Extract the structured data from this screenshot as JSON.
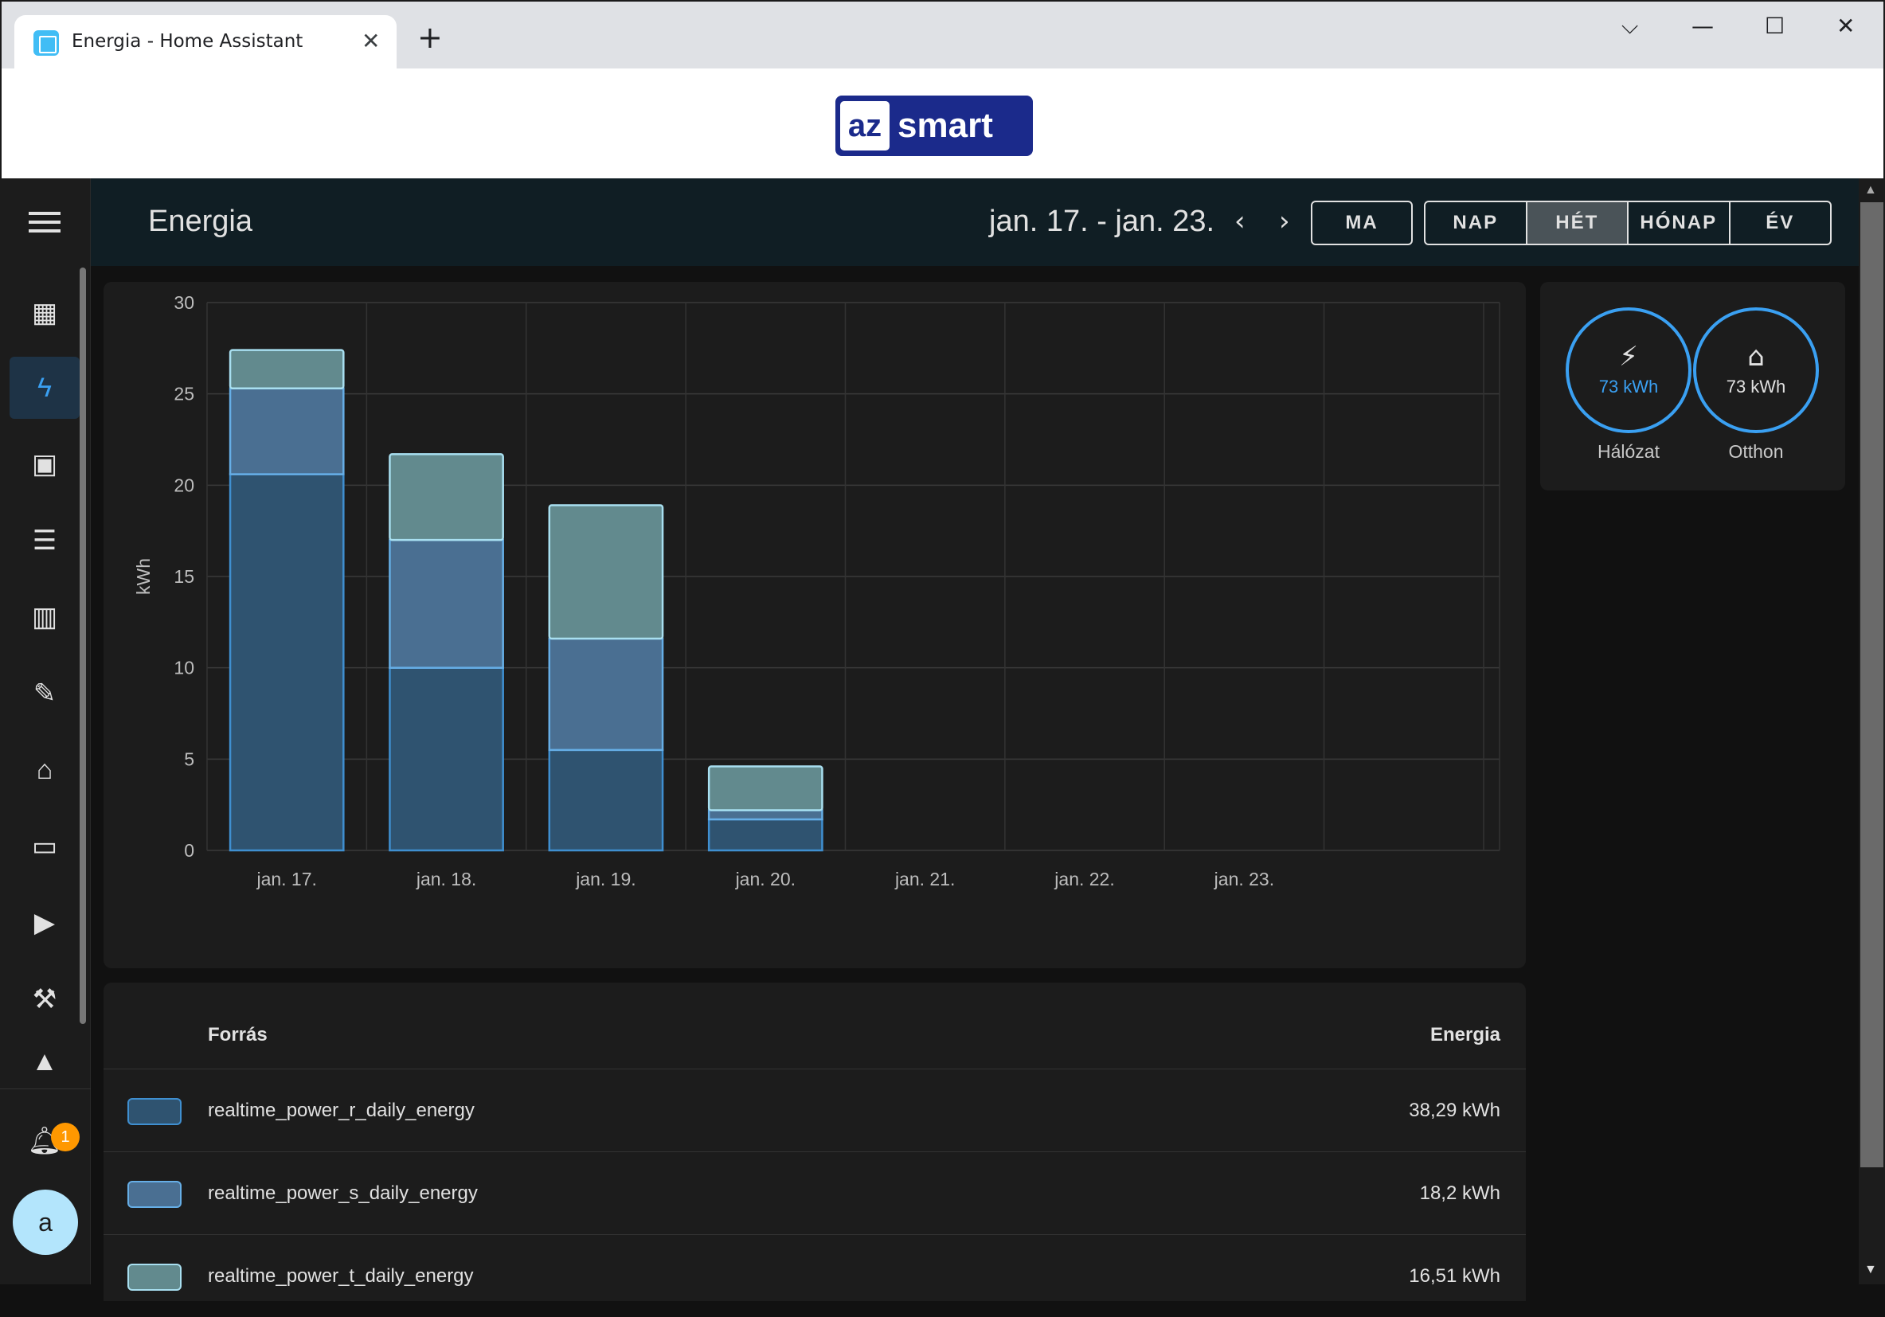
{
  "browser": {
    "tab_title": "Energia - Home Assistant",
    "tab_close": "✕",
    "new_tab": "+",
    "win_chevron": "⌵",
    "win_minimize": "—",
    "win_maximize": "☐",
    "win_close": "✕"
  },
  "brand": {
    "logo_part1": "az",
    "logo_part2": "smart"
  },
  "header": {
    "title": "Energia",
    "date_range": "jan. 17. - jan. 23.",
    "prev": "‹",
    "next": "›",
    "today_btn": "MA",
    "periods": [
      "NAP",
      "HÉT",
      "HÓNAP",
      "ÉV"
    ],
    "selected_period": "HÉT"
  },
  "sidebar": {
    "notification_count": "1",
    "avatar_letter": "a",
    "items": [
      {
        "name": "overview",
        "icon": "dashboard-icon",
        "glyph": "▦"
      },
      {
        "name": "energy",
        "icon": "lightning-icon",
        "glyph": "ϟ"
      },
      {
        "name": "map",
        "icon": "person-card-icon",
        "glyph": "▣"
      },
      {
        "name": "logbook",
        "icon": "list-icon",
        "glyph": "☰"
      },
      {
        "name": "history",
        "icon": "bar-chart-icon",
        "glyph": "▥"
      },
      {
        "name": "tools",
        "icon": "wrench-icon",
        "glyph": "✎"
      },
      {
        "name": "hacs",
        "icon": "store-icon",
        "glyph": "⌂"
      },
      {
        "name": "terminal",
        "icon": "terminal-icon",
        "glyph": "▭"
      },
      {
        "name": "media",
        "icon": "media-icon",
        "glyph": "▶"
      },
      {
        "name": "developer",
        "icon": "hammer-icon",
        "glyph": "⚒"
      },
      {
        "name": "more",
        "icon": "car-icon",
        "glyph": "▲"
      }
    ]
  },
  "energy_flow": {
    "grid": {
      "icon": "transmission-tower-icon",
      "glyph": "⚡",
      "value": "73 kWh",
      "label": "Hálózat",
      "color": "#3aa0f2"
    },
    "home": {
      "icon": "home-icon",
      "glyph": "⌂",
      "value": "73 kWh",
      "label": "Otthon",
      "color": "#e1e1e1"
    }
  },
  "chart_data": {
    "type": "bar",
    "stacked": true,
    "categories": [
      "jan. 17.",
      "jan. 18.",
      "jan. 19.",
      "jan. 20.",
      "jan. 21.",
      "jan. 22.",
      "jan. 23."
    ],
    "series": [
      {
        "name": "realtime_power_r_daily_energy",
        "values": [
          20.6,
          10.0,
          5.5,
          1.7,
          0,
          0,
          0
        ],
        "fill": "#2f5370",
        "stroke": "#3f8fd0"
      },
      {
        "name": "realtime_power_s_daily_energy",
        "values": [
          4.7,
          7.0,
          6.1,
          0.5,
          0,
          0,
          0
        ],
        "fill": "#4a6f92",
        "stroke": "#66aee6"
      },
      {
        "name": "realtime_power_t_daily_energy",
        "values": [
          2.1,
          4.7,
          7.3,
          2.4,
          0,
          0,
          0
        ],
        "fill": "#628a8e",
        "stroke": "#a8dff0"
      }
    ],
    "ylabel": "kWh",
    "ylim": [
      0,
      30
    ],
    "yticks": [
      0,
      5,
      10,
      15,
      20,
      25,
      30
    ],
    "grid": true
  },
  "table": {
    "col_source": "Forrás",
    "col_energy": "Energia",
    "rows": [
      {
        "name": "realtime_power_r_daily_energy",
        "value": "38,29 kWh",
        "color": "#2f5370",
        "border": "#3f8fd0"
      },
      {
        "name": "realtime_power_s_daily_energy",
        "value": "18,2 kWh",
        "color": "#4a6f92",
        "border": "#66aee6"
      },
      {
        "name": "realtime_power_t_daily_energy",
        "value": "16,51 kWh",
        "color": "#628a8e",
        "border": "#a8dff0"
      }
    ]
  }
}
